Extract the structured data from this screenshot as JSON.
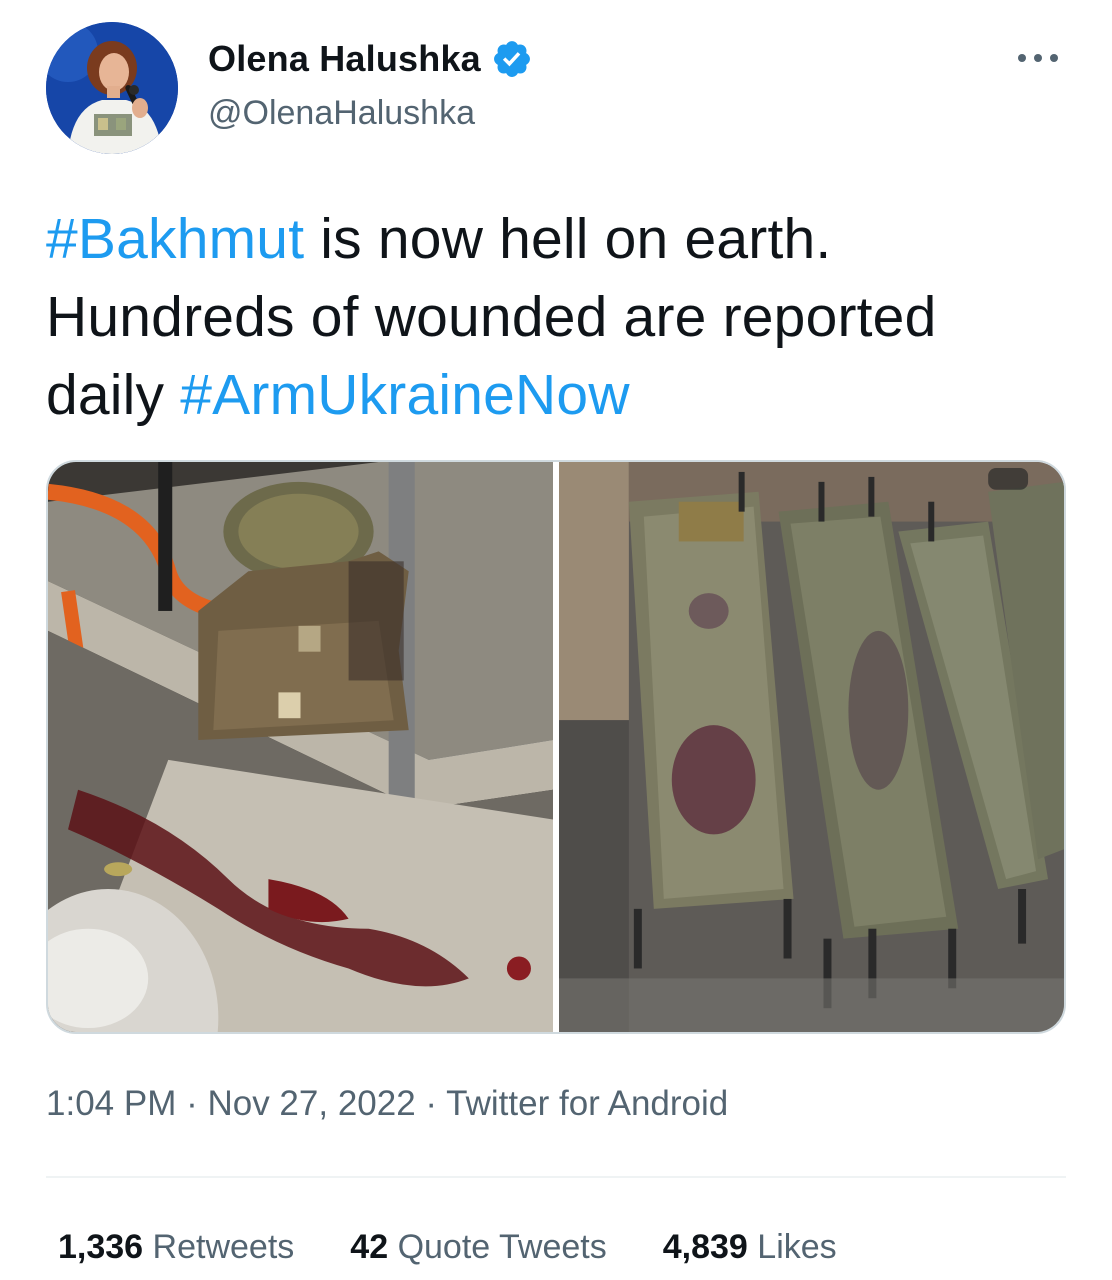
{
  "author": {
    "display_name": "Olena Halushka",
    "handle": "@OlenaHalushka",
    "verified": true,
    "avatar_icon": "profile-photo"
  },
  "tweet": {
    "hashtag_1": "#Bakhmut",
    "text_1": " is now hell on earth. Hundreds of wounded are reported daily ",
    "hashtag_2": "#ArmUkraineNow"
  },
  "media": [
    {
      "icon": "photo-body-armor-bloodstained-ground"
    },
    {
      "icon": "photo-bloodstained-stretchers"
    }
  ],
  "meta": {
    "time": "1:04 PM",
    "separator": " · ",
    "date": "Nov 27, 2022",
    "source": "Twitter for Android"
  },
  "stats": {
    "retweets_count": "1,336",
    "retweets_label": "Retweets",
    "quotes_count": "42",
    "quotes_label": "Quote Tweets",
    "likes_count": "4,839",
    "likes_label": "Likes"
  },
  "colors": {
    "link": "#1d9bf0",
    "secondary_text": "#536471",
    "primary_text": "#0f1419",
    "verified_badge": "#1d9bf0"
  }
}
